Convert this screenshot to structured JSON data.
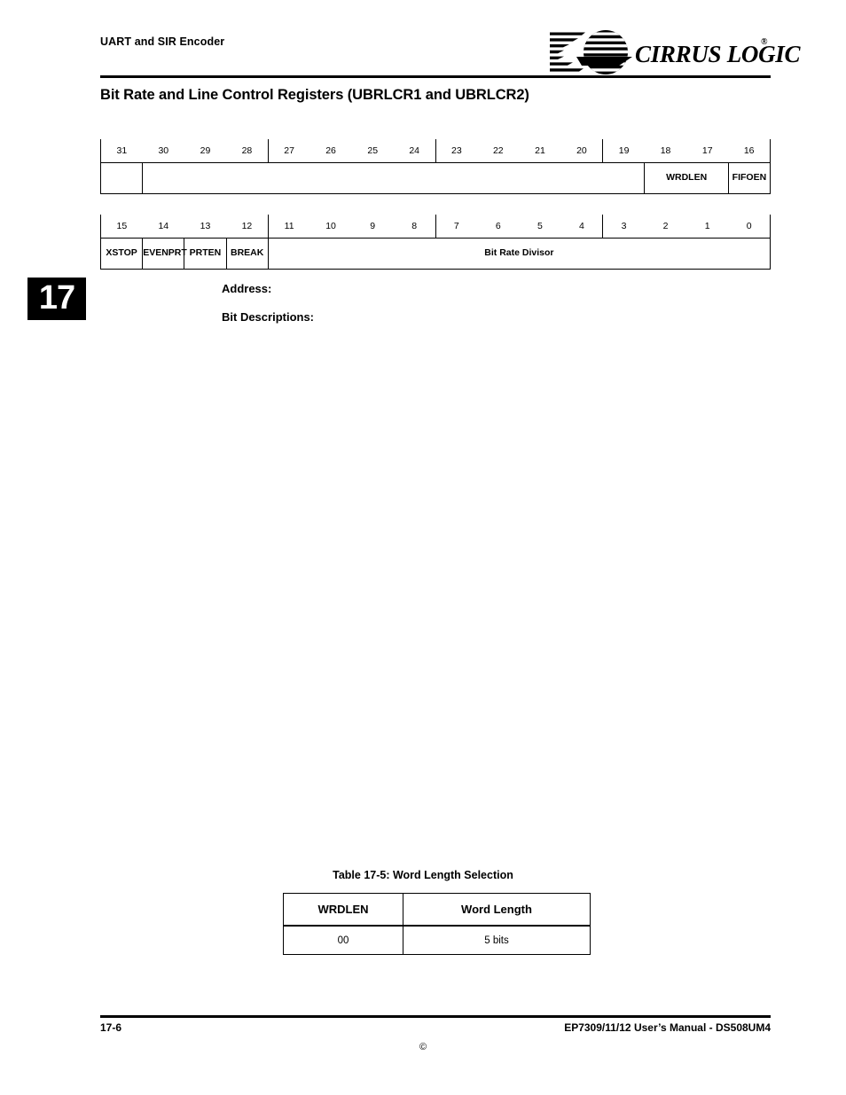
{
  "header": {
    "running_head": "UART and SIR Encoder",
    "logo_wordmark": "CIRRUS LOGIC",
    "logo_registered": "®",
    "logo_mark_name": "cirrus-logic-sphere-logo"
  },
  "page_title": "Bit Rate and Line Control Registers (UBRLCR1 and UBRLCR2)",
  "chapter_tab": {
    "number": "17"
  },
  "register_high": {
    "bit_numbers": [
      "31",
      "30",
      "29",
      "28",
      "27",
      "26",
      "25",
      "24",
      "23",
      "22",
      "21",
      "20",
      "19",
      "18",
      "17",
      "16"
    ],
    "fields": [
      {
        "label": "",
        "span": 1
      },
      {
        "label": "",
        "span": 12
      },
      {
        "label": "WRDLEN",
        "span": 2
      },
      {
        "label": "FIFOEN",
        "span": 1
      }
    ]
  },
  "register_low": {
    "bit_numbers": [
      "15",
      "14",
      "13",
      "12",
      "11",
      "10",
      "9",
      "8",
      "7",
      "6",
      "5",
      "4",
      "3",
      "2",
      "1",
      "0"
    ],
    "fields": [
      {
        "label": "XSTOP",
        "span": 1
      },
      {
        "label": "EVENPRT",
        "span": 1
      },
      {
        "label": "PRTEN",
        "span": 1
      },
      {
        "label": "BREAK",
        "span": 1
      },
      {
        "label": "Bit Rate Divisor",
        "span": 12
      }
    ]
  },
  "sections": {
    "address_label": "Address:",
    "bit_descriptions_label": "Bit Descriptions:"
  },
  "word_length_table": {
    "caption": "Table 17-5: Word Length Selection",
    "columns": [
      "WRDLEN",
      "Word Length"
    ],
    "rows": [
      [
        "00",
        "5 bits"
      ]
    ]
  },
  "footer": {
    "page_number": "17-6",
    "manual": "EP7309/11/12 User’s Manual - DS508UM4",
    "copyright_symbol": "©"
  }
}
